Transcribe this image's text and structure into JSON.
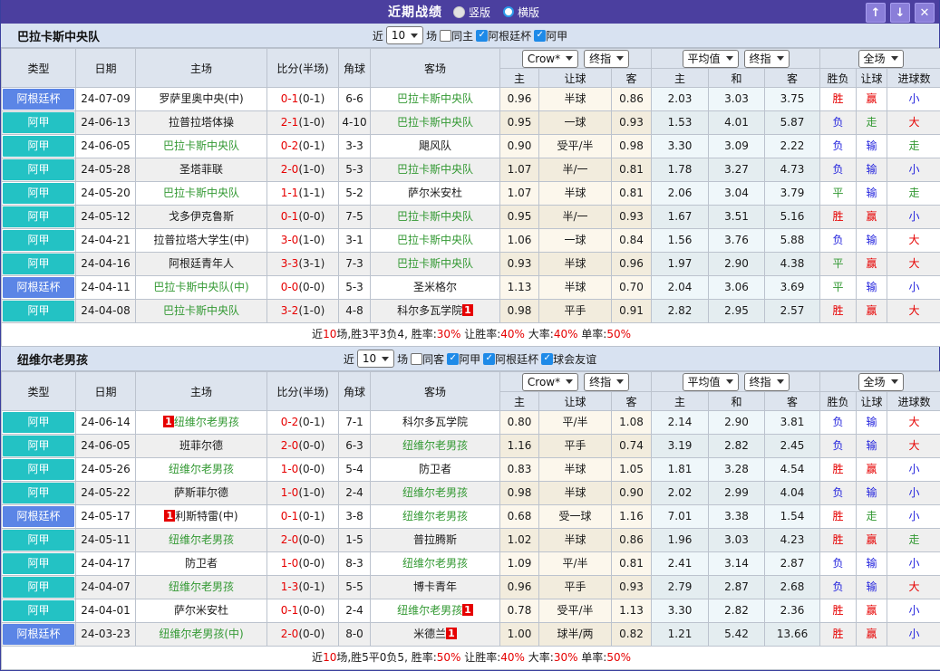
{
  "titlebar": {
    "title": "近期战绩",
    "radios": [
      {
        "label": "竖版",
        "selected": true
      },
      {
        "label": "横版",
        "selected": false
      }
    ],
    "buttons": {
      "up": "↑",
      "down": "↓",
      "close": "✕"
    }
  },
  "table_header": {
    "left_cols": [
      "类型",
      "日期",
      "主场",
      "比分(半场)",
      "角球",
      "客场"
    ],
    "dropdowns": {
      "odds_source": "Crow*",
      "odds_stage": "终指",
      "avg_source": "平均值",
      "avg_stage": "终指",
      "scope": "全场"
    },
    "sub_cols": [
      "主",
      "让球",
      "客",
      "主",
      "和",
      "客",
      "胜负",
      "让球",
      "进球数"
    ]
  },
  "colors": {
    "league": {
      "阿根廷杯": "#5b85e6",
      "阿甲": "#23c2c4"
    },
    "result_red": "#e60000",
    "result_blue": "#2323dd",
    "result_green": "#339933",
    "focal_team_green": "#339933",
    "badge_red": "#e60000",
    "titlebar_purple": "#4b3f9f"
  },
  "sections": [
    {
      "team": "巴拉卡斯中央队",
      "filter": {
        "prefix": "近",
        "count": "10",
        "suffix": "场",
        "checkboxes": [
          {
            "label": "同主",
            "checked": false
          },
          {
            "label": "阿根廷杯",
            "checked": true
          },
          {
            "label": "阿甲",
            "checked": true
          }
        ]
      },
      "rows": [
        {
          "league": "阿根廷杯",
          "date": "24-07-09",
          "home": "罗萨里奥中央(中)",
          "home_focal": false,
          "home_badge": "",
          "score": "0-1",
          "half": "(0-1)",
          "corner": "6-6",
          "away": "巴拉卡斯中央队",
          "away_focal": true,
          "away_badge": "",
          "odds": [
            "0.96",
            "半球",
            "0.86"
          ],
          "avg": [
            "2.03",
            "3.03",
            "3.75"
          ],
          "results": [
            "胜",
            "赢",
            "小"
          ]
        },
        {
          "league": "阿甲",
          "date": "24-06-13",
          "home": "拉普拉塔体操",
          "home_focal": false,
          "home_badge": "",
          "score": "2-1",
          "half": "(1-0)",
          "corner": "4-10",
          "away": "巴拉卡斯中央队",
          "away_focal": true,
          "away_badge": "",
          "odds": [
            "0.95",
            "一球",
            "0.93"
          ],
          "avg": [
            "1.53",
            "4.01",
            "5.87"
          ],
          "results": [
            "负",
            "走",
            "大"
          ]
        },
        {
          "league": "阿甲",
          "date": "24-06-05",
          "home": "巴拉卡斯中央队",
          "home_focal": true,
          "home_badge": "",
          "score": "0-2",
          "half": "(0-1)",
          "corner": "3-3",
          "away": "飓风队",
          "away_focal": false,
          "away_badge": "",
          "odds": [
            "0.90",
            "受平/半",
            "0.98"
          ],
          "avg": [
            "3.30",
            "3.09",
            "2.22"
          ],
          "results": [
            "负",
            "输",
            "走"
          ]
        },
        {
          "league": "阿甲",
          "date": "24-05-28",
          "home": "圣塔菲联",
          "home_focal": false,
          "home_badge": "",
          "score": "2-0",
          "half": "(1-0)",
          "corner": "5-3",
          "away": "巴拉卡斯中央队",
          "away_focal": true,
          "away_badge": "",
          "odds": [
            "1.07",
            "半/一",
            "0.81"
          ],
          "avg": [
            "1.78",
            "3.27",
            "4.73"
          ],
          "results": [
            "负",
            "输",
            "小"
          ]
        },
        {
          "league": "阿甲",
          "date": "24-05-20",
          "home": "巴拉卡斯中央队",
          "home_focal": true,
          "home_badge": "",
          "score": "1-1",
          "half": "(1-1)",
          "corner": "5-2",
          "away": "萨尔米安杜",
          "away_focal": false,
          "away_badge": "",
          "odds": [
            "1.07",
            "半球",
            "0.81"
          ],
          "avg": [
            "2.06",
            "3.04",
            "3.79"
          ],
          "results": [
            "平",
            "输",
            "走"
          ]
        },
        {
          "league": "阿甲",
          "date": "24-05-12",
          "home": "戈多伊克鲁斯",
          "home_focal": false,
          "home_badge": "",
          "score": "0-1",
          "half": "(0-0)",
          "corner": "7-5",
          "away": "巴拉卡斯中央队",
          "away_focal": true,
          "away_badge": "",
          "odds": [
            "0.95",
            "半/一",
            "0.93"
          ],
          "avg": [
            "1.67",
            "3.51",
            "5.16"
          ],
          "results": [
            "胜",
            "赢",
            "小"
          ]
        },
        {
          "league": "阿甲",
          "date": "24-04-21",
          "home": "拉普拉塔大学生(中)",
          "home_focal": false,
          "home_badge": "",
          "score": "3-0",
          "half": "(1-0)",
          "corner": "3-1",
          "away": "巴拉卡斯中央队",
          "away_focal": true,
          "away_badge": "",
          "odds": [
            "1.06",
            "一球",
            "0.84"
          ],
          "avg": [
            "1.56",
            "3.76",
            "5.88"
          ],
          "results": [
            "负",
            "输",
            "大"
          ]
        },
        {
          "league": "阿甲",
          "date": "24-04-16",
          "home": "阿根廷青年人",
          "home_focal": false,
          "home_badge": "",
          "score": "3-3",
          "half": "(3-1)",
          "corner": "7-3",
          "away": "巴拉卡斯中央队",
          "away_focal": true,
          "away_badge": "",
          "odds": [
            "0.93",
            "半球",
            "0.96"
          ],
          "avg": [
            "1.97",
            "2.90",
            "4.38"
          ],
          "results": [
            "平",
            "赢",
            "大"
          ]
        },
        {
          "league": "阿根廷杯",
          "date": "24-04-11",
          "home": "巴拉卡斯中央队(中)",
          "home_focal": true,
          "home_badge": "",
          "score": "0-0",
          "half": "(0-0)",
          "corner": "5-3",
          "away": "圣米格尔",
          "away_focal": false,
          "away_badge": "",
          "odds": [
            "1.13",
            "半球",
            "0.70"
          ],
          "avg": [
            "2.04",
            "3.06",
            "3.69"
          ],
          "results": [
            "平",
            "输",
            "小"
          ]
        },
        {
          "league": "阿甲",
          "date": "24-04-08",
          "home": "巴拉卡斯中央队",
          "home_focal": true,
          "home_badge": "",
          "score": "3-2",
          "half": "(1-0)",
          "corner": "4-8",
          "away": "科尔多瓦学院",
          "away_focal": false,
          "away_badge": "1",
          "odds": [
            "0.98",
            "平手",
            "0.91"
          ],
          "avg": [
            "2.82",
            "2.95",
            "2.57"
          ],
          "results": [
            "胜",
            "赢",
            "大"
          ]
        }
      ],
      "summary": [
        {
          "text": "近"
        },
        {
          "text": "10",
          "red": true
        },
        {
          "text": "场,胜3平3负4, 胜率:"
        },
        {
          "text": "30%",
          "red": true
        },
        {
          "text": " 让胜率:"
        },
        {
          "text": "40%",
          "red": true
        },
        {
          "text": " 大率:"
        },
        {
          "text": "40%",
          "red": true
        },
        {
          "text": " 单率:"
        },
        {
          "text": "50%",
          "red": true
        }
      ]
    },
    {
      "team": "纽维尔老男孩",
      "filter": {
        "prefix": "近",
        "count": "10",
        "suffix": "场",
        "checkboxes": [
          {
            "label": "同客",
            "checked": false
          },
          {
            "label": "阿甲",
            "checked": true
          },
          {
            "label": "阿根廷杯",
            "checked": true
          },
          {
            "label": "球会友谊",
            "checked": true
          }
        ]
      },
      "rows": [
        {
          "league": "阿甲",
          "date": "24-06-14",
          "home": "纽维尔老男孩",
          "home_focal": true,
          "home_badge": "1",
          "score": "0-2",
          "half": "(0-1)",
          "corner": "7-1",
          "away": "科尔多瓦学院",
          "away_focal": false,
          "away_badge": "",
          "odds": [
            "0.80",
            "平/半",
            "1.08"
          ],
          "avg": [
            "2.14",
            "2.90",
            "3.81"
          ],
          "results": [
            "负",
            "输",
            "大"
          ]
        },
        {
          "league": "阿甲",
          "date": "24-06-05",
          "home": "班菲尔德",
          "home_focal": false,
          "home_badge": "",
          "score": "2-0",
          "half": "(0-0)",
          "corner": "6-3",
          "away": "纽维尔老男孩",
          "away_focal": true,
          "away_badge": "",
          "odds": [
            "1.16",
            "平手",
            "0.74"
          ],
          "avg": [
            "3.19",
            "2.82",
            "2.45"
          ],
          "results": [
            "负",
            "输",
            "大"
          ]
        },
        {
          "league": "阿甲",
          "date": "24-05-26",
          "home": "纽维尔老男孩",
          "home_focal": true,
          "home_badge": "",
          "score": "1-0",
          "half": "(0-0)",
          "corner": "5-4",
          "away": "防卫者",
          "away_focal": false,
          "away_badge": "",
          "odds": [
            "0.83",
            "半球",
            "1.05"
          ],
          "avg": [
            "1.81",
            "3.28",
            "4.54"
          ],
          "results": [
            "胜",
            "赢",
            "小"
          ]
        },
        {
          "league": "阿甲",
          "date": "24-05-22",
          "home": "萨斯菲尔德",
          "home_focal": false,
          "home_badge": "",
          "score": "1-0",
          "half": "(1-0)",
          "corner": "2-4",
          "away": "纽维尔老男孩",
          "away_focal": true,
          "away_badge": "",
          "odds": [
            "0.98",
            "半球",
            "0.90"
          ],
          "avg": [
            "2.02",
            "2.99",
            "4.04"
          ],
          "results": [
            "负",
            "输",
            "小"
          ]
        },
        {
          "league": "阿根廷杯",
          "date": "24-05-17",
          "home": "利斯特雷(中)",
          "home_focal": false,
          "home_badge": "1",
          "score": "0-1",
          "half": "(0-1)",
          "corner": "3-8",
          "away": "纽维尔老男孩",
          "away_focal": true,
          "away_badge": "",
          "odds": [
            "0.68",
            "受一球",
            "1.16"
          ],
          "avg": [
            "7.01",
            "3.38",
            "1.54"
          ],
          "results": [
            "胜",
            "走",
            "小"
          ]
        },
        {
          "league": "阿甲",
          "date": "24-05-11",
          "home": "纽维尔老男孩",
          "home_focal": true,
          "home_badge": "",
          "score": "2-0",
          "half": "(0-0)",
          "corner": "1-5",
          "away": "普拉腾斯",
          "away_focal": false,
          "away_badge": "",
          "odds": [
            "1.02",
            "半球",
            "0.86"
          ],
          "avg": [
            "1.96",
            "3.03",
            "4.23"
          ],
          "results": [
            "胜",
            "赢",
            "走"
          ]
        },
        {
          "league": "阿甲",
          "date": "24-04-17",
          "home": "防卫者",
          "home_focal": false,
          "home_badge": "",
          "score": "1-0",
          "half": "(0-0)",
          "corner": "8-3",
          "away": "纽维尔老男孩",
          "away_focal": true,
          "away_badge": "",
          "odds": [
            "1.09",
            "平/半",
            "0.81"
          ],
          "avg": [
            "2.41",
            "3.14",
            "2.87"
          ],
          "results": [
            "负",
            "输",
            "小"
          ]
        },
        {
          "league": "阿甲",
          "date": "24-04-07",
          "home": "纽维尔老男孩",
          "home_focal": true,
          "home_badge": "",
          "score": "1-3",
          "half": "(0-1)",
          "corner": "5-5",
          "away": "博卡青年",
          "away_focal": false,
          "away_badge": "",
          "odds": [
            "0.96",
            "平手",
            "0.93"
          ],
          "avg": [
            "2.79",
            "2.87",
            "2.68"
          ],
          "results": [
            "负",
            "输",
            "大"
          ]
        },
        {
          "league": "阿甲",
          "date": "24-04-01",
          "home": "萨尔米安杜",
          "home_focal": false,
          "home_badge": "",
          "score": "0-1",
          "half": "(0-0)",
          "corner": "2-4",
          "away": "纽维尔老男孩",
          "away_focal": true,
          "away_badge": "1",
          "odds": [
            "0.78",
            "受平/半",
            "1.13"
          ],
          "avg": [
            "3.30",
            "2.82",
            "2.36"
          ],
          "results": [
            "胜",
            "赢",
            "小"
          ]
        },
        {
          "league": "阿根廷杯",
          "date": "24-03-23",
          "home": "纽维尔老男孩(中)",
          "home_focal": true,
          "home_badge": "",
          "score": "2-0",
          "half": "(0-0)",
          "corner": "8-0",
          "away": "米德兰",
          "away_focal": false,
          "away_badge": "1",
          "odds": [
            "1.00",
            "球半/两",
            "0.82"
          ],
          "avg": [
            "1.21",
            "5.42",
            "13.66"
          ],
          "results": [
            "胜",
            "赢",
            "小"
          ]
        }
      ],
      "summary": [
        {
          "text": "近"
        },
        {
          "text": "10",
          "red": true
        },
        {
          "text": "场,胜5平0负5, 胜率:"
        },
        {
          "text": "50%",
          "red": true
        },
        {
          "text": " 让胜率:"
        },
        {
          "text": "40%",
          "red": true
        },
        {
          "text": " 大率:"
        },
        {
          "text": "30%",
          "red": true
        },
        {
          "text": " 单率:"
        },
        {
          "text": "50%",
          "red": true
        }
      ]
    }
  ]
}
